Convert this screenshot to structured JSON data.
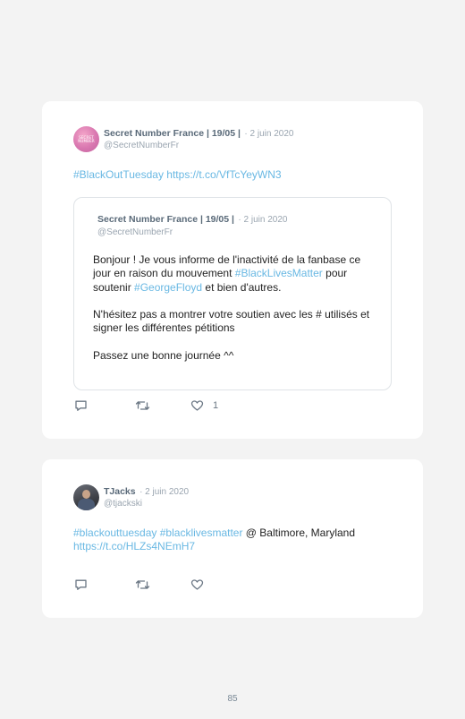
{
  "tweets": [
    {
      "author": "Secret Number France | 19/05 |",
      "date": "· 2 juin 2020",
      "handle": "@SecretNumberFr",
      "avatar_logo": "SECRET NUMBER",
      "body_hashtag": "#BlackOutTuesday",
      "body_link": "https://t.co/VfTcYeyWN3",
      "quoted": {
        "author": "Secret Number France | 19/05 |",
        "date": "· 2 juin 2020",
        "handle": "@SecretNumberFr",
        "p1_a": "Bonjour ! Je vous informe de l'inactivité de la fanbase ce jour en raison du mouvement ",
        "p1_tag1": "#BlackLivesMatter",
        "p1_b": " pour soutenir ",
        "p1_tag2": "#GeorgeFloyd",
        "p1_c": " et bien d'autres.",
        "p2": "N'hésitez pas a montrer votre soutien avec les # utilisés et signer les différentes pétitions",
        "p3": "Passez une bonne journée ^^"
      },
      "likes": "1"
    },
    {
      "author": "TJacks",
      "date": "· 2 juin 2020",
      "handle": "@tjackski",
      "tag1": "#blackouttuesday",
      "tag2": "#blacklivesmatter",
      "location": " @ Baltimore, Maryland",
      "link": "https://t.co/HLZs4NEmH7"
    }
  ],
  "icons": [
    "reply-icon",
    "retweet-icon",
    "like-icon"
  ],
  "colors": {
    "link": "#69b8e3",
    "background": "#f3f3f3",
    "card": "#ffffff"
  },
  "page_number": "85"
}
